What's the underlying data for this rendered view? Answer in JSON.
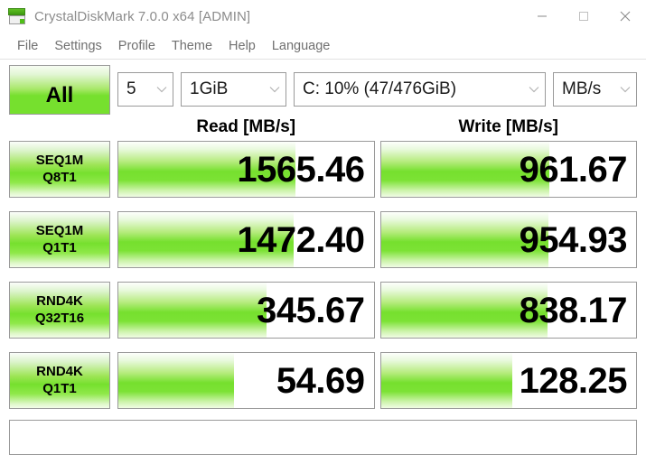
{
  "window": {
    "title": "CrystalDiskMark 7.0.0 x64 [ADMIN]",
    "icon": "disk-drive-icon",
    "controls": {
      "minimize": "minimize-icon",
      "maximize": "maximize-icon",
      "close": "close-icon"
    }
  },
  "menu": {
    "items": [
      {
        "label": "File"
      },
      {
        "label": "Settings"
      },
      {
        "label": "Profile"
      },
      {
        "label": "Theme"
      },
      {
        "label": "Help"
      },
      {
        "label": "Language"
      }
    ]
  },
  "toolbar": {
    "all_button": "All",
    "test_count": "5",
    "test_size": "1GiB",
    "drive": "C: 10% (47/476GiB)",
    "unit": "MB/s",
    "chevron": "chevron-down-icon"
  },
  "headers": {
    "read": "Read [MB/s]",
    "write": "Write [MB/s]"
  },
  "status": {
    "text": ""
  },
  "colors": {
    "bar_green": "#76e02e",
    "border": "#9a9a9a",
    "title_text": "#8c8c8c",
    "menu_text": "#707070"
  },
  "chart_data": {
    "type": "bar",
    "title": "CrystalDiskMark 7.0.0 x64 [ADMIN]",
    "xlabel": "",
    "ylabel": "",
    "unit": "MB/s",
    "drive": "C: 10% (47/476GiB)",
    "test_count": 5,
    "test_size": "1GiB",
    "categories": [
      "SEQ1M Q8T1",
      "SEQ1M Q1T1",
      "RND4K Q32T16",
      "RND4K Q1T1"
    ],
    "series": [
      {
        "name": "Read [MB/s]",
        "values": [
          1565.46,
          1472.4,
          345.67,
          54.69
        ]
      },
      {
        "name": "Write [MB/s]",
        "values": [
          961.67,
          954.93,
          838.17,
          128.25
        ]
      }
    ],
    "legend_position": "top"
  },
  "rows": [
    {
      "label_line1": "SEQ1M",
      "label_line2": "Q8T1",
      "read": {
        "value": "1565.46",
        "fill_pct": 69.5
      },
      "write": {
        "value": "961.67",
        "fill_pct": 66.0
      }
    },
    {
      "label_line1": "SEQ1M",
      "label_line2": "Q1T1",
      "read": {
        "value": "1472.40",
        "fill_pct": 68.8
      },
      "write": {
        "value": "954.93",
        "fill_pct": 65.8
      }
    },
    {
      "label_line1": "RND4K",
      "label_line2": "Q32T16",
      "read": {
        "value": "345.67",
        "fill_pct": 58.2
      },
      "write": {
        "value": "838.17",
        "fill_pct": 65.2
      }
    },
    {
      "label_line1": "RND4K",
      "label_line2": "Q1T1",
      "read": {
        "value": "54.69",
        "fill_pct": 45.2
      },
      "write": {
        "value": "128.25",
        "fill_pct": 51.5
      }
    }
  ]
}
